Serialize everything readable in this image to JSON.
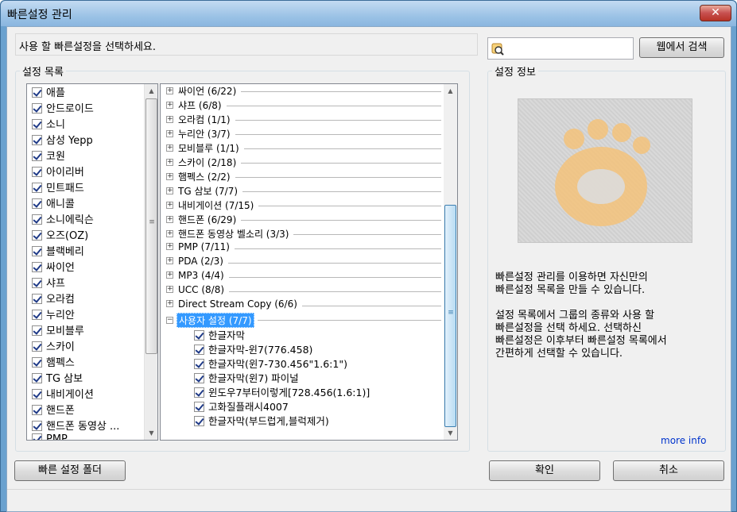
{
  "window": {
    "title": "빠른설정 관리",
    "close_label": "✕"
  },
  "instruction": "사용 할 빠른설정을 선택하세요.",
  "search": {
    "value": "",
    "placeholder": "",
    "button_label": "웹에서 검색"
  },
  "settings_list": {
    "group_label": "설정 목록",
    "items": [
      "애플",
      "안드로이드",
      "소니",
      "삼성 Yepp",
      "코원",
      "아이리버",
      "민트패드",
      "애니콜",
      "소니에릭슨",
      "오즈(OZ)",
      "블랙베리",
      "싸이언",
      "샤프",
      "오라컴",
      "누리안",
      "모비블루",
      "스카이",
      "햄펙스",
      "TG 삼보",
      "내비게이션",
      "핸드폰",
      "핸드폰 동영상 ...",
      "PMP"
    ]
  },
  "tree": {
    "nodes": [
      {
        "label": "싸이언 (6/22)",
        "expander": "+"
      },
      {
        "label": "샤프 (6/8)",
        "expander": "+"
      },
      {
        "label": "오라컴 (1/1)",
        "expander": "+"
      },
      {
        "label": "누리안 (3/7)",
        "expander": "+"
      },
      {
        "label": "모비블루 (1/1)",
        "expander": "+"
      },
      {
        "label": "스카이 (2/18)",
        "expander": "+"
      },
      {
        "label": "햄펙스 (2/2)",
        "expander": "+"
      },
      {
        "label": "TG 삼보 (7/7)",
        "expander": "+"
      },
      {
        "label": "내비게이션 (7/15)",
        "expander": "+"
      },
      {
        "label": "핸드폰 (6/29)",
        "expander": "+"
      },
      {
        "label": "핸드폰 동영상 벨소리 (3/3)",
        "expander": "+"
      },
      {
        "label": "PMP (7/11)",
        "expander": "+"
      },
      {
        "label": "PDA (2/3)",
        "expander": "+"
      },
      {
        "label": "MP3 (4/4)",
        "expander": "+"
      },
      {
        "label": "UCC (8/8)",
        "expander": "+"
      },
      {
        "label": "Direct Stream Copy (6/6)",
        "expander": "+"
      },
      {
        "label": "사용자 설정 (7/7)",
        "expander": "−"
      }
    ],
    "children": [
      "한글자막",
      "한글자막-윈7(776.458)",
      "한글자막(윈7-730.456\"1.6:1\")",
      "한글자막(윈7) 파이널",
      "윈도우7부터이렇게[728.456(1.6:1)]",
      "고화질플래시4007",
      "한글자막(부드럽게,블럭제거)"
    ]
  },
  "info": {
    "group_label": "설정 정보",
    "text": "빠른설정 관리를 이용하면 자신만의\n빠른설정 목록을 만들 수 있습니다.\n\n설정 목록에서 그룹의 종류와 사용 할\n빠른설정을 선택 하세요. 선택하신\n빠른설정은 이후부터 빠른설정 목록에서\n간편하게 선택할 수 있습니다.",
    "more_info": "more info"
  },
  "buttons": {
    "folder": "빠른 설정 폴더",
    "ok": "확인",
    "cancel": "취소"
  },
  "colors": {
    "selection": "#3399ff",
    "title_bar": "#9cc3e6",
    "close": "#c75050"
  }
}
